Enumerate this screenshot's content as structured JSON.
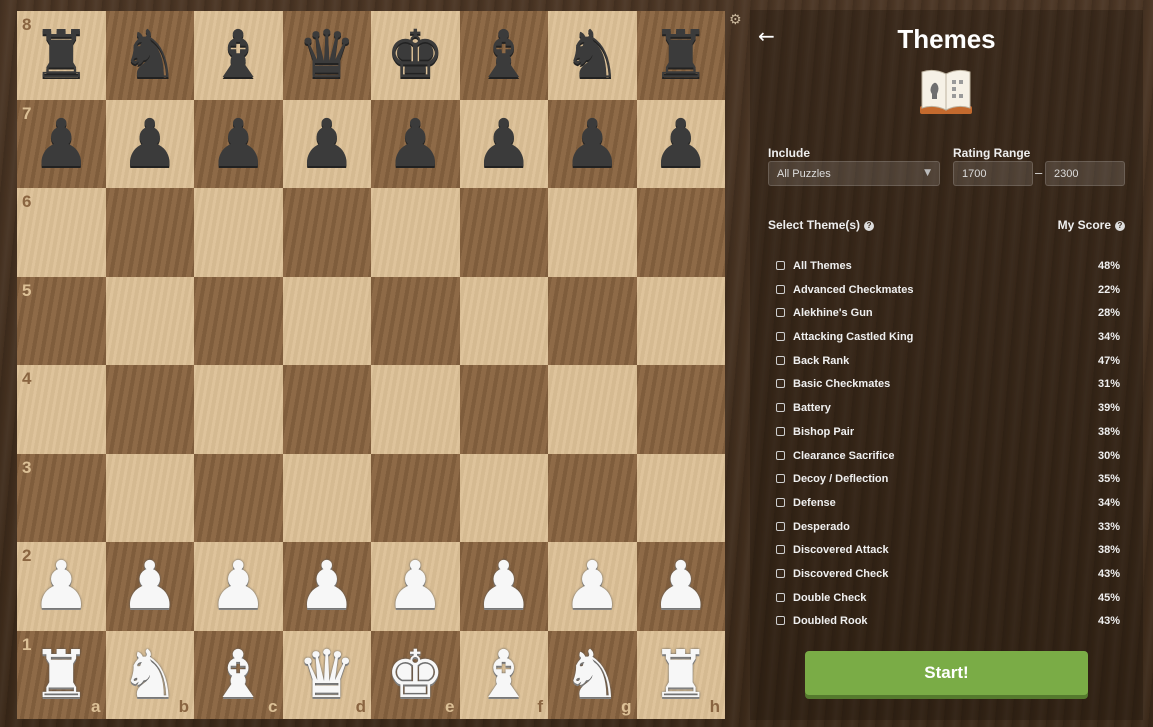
{
  "board": {
    "ranks": [
      "8",
      "7",
      "6",
      "5",
      "4",
      "3",
      "2",
      "1"
    ],
    "files": [
      "a",
      "b",
      "c",
      "d",
      "e",
      "f",
      "g",
      "h"
    ],
    "pieces": {
      "8": [
        "♜",
        "♞",
        "♝",
        "♛",
        "♚",
        "♝",
        "♞",
        "♜"
      ],
      "7": [
        "♟",
        "♟",
        "♟",
        "♟",
        "♟",
        "♟",
        "♟",
        "♟"
      ],
      "2": [
        "♟",
        "♟",
        "♟",
        "♟",
        "♟",
        "♟",
        "♟",
        "♟"
      ],
      "1": [
        "♜",
        "♞",
        "♝",
        "♛",
        "♚",
        "♝",
        "♞",
        "♜"
      ]
    },
    "settings_icon": "gear-icon"
  },
  "panel": {
    "back_icon": "←",
    "title": "Themes",
    "include_label": "Include",
    "include_value": "All Puzzles",
    "rating_label": "Rating Range",
    "rating_min": "1700",
    "rating_sep": "–",
    "rating_max": "2300",
    "select_themes_label": "Select Theme(s)",
    "my_score_label": "My Score",
    "themes": [
      {
        "name": "All Themes",
        "score": "48%"
      },
      {
        "name": "Advanced Checkmates",
        "score": "22%"
      },
      {
        "name": "Alekhine's Gun",
        "score": "28%"
      },
      {
        "name": "Attacking Castled King",
        "score": "34%"
      },
      {
        "name": "Back Rank",
        "score": "47%"
      },
      {
        "name": "Basic Checkmates",
        "score": "31%"
      },
      {
        "name": "Battery",
        "score": "39%"
      },
      {
        "name": "Bishop Pair",
        "score": "38%"
      },
      {
        "name": "Clearance Sacrifice",
        "score": "30%"
      },
      {
        "name": "Decoy / Deflection",
        "score": "35%"
      },
      {
        "name": "Defense",
        "score": "34%"
      },
      {
        "name": "Desperado",
        "score": "33%"
      },
      {
        "name": "Discovered Attack",
        "score": "38%"
      },
      {
        "name": "Discovered Check",
        "score": "43%"
      },
      {
        "name": "Double Check",
        "score": "45%"
      },
      {
        "name": "Doubled Rook",
        "score": "43%"
      }
    ],
    "start_label": "Start!",
    "accent_color": "#7aac46"
  }
}
